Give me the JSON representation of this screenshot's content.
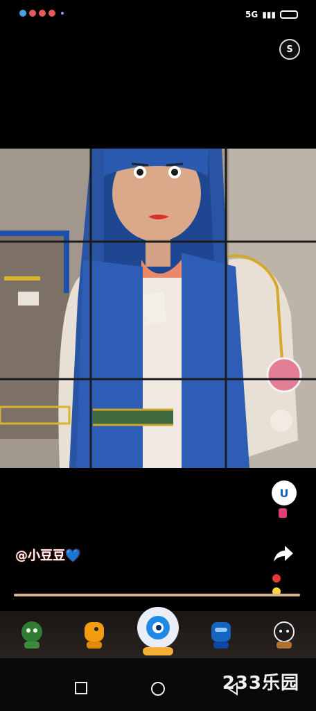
{
  "status_bar": {
    "right_text": "5G"
  },
  "top_icon": {
    "label": "S"
  },
  "photo": {
    "subject": "clay-figure-portrait",
    "grid": "3x3"
  },
  "side_actions": [
    {
      "name": "avatar-sticker",
      "icon": "avatar-icon"
    },
    {
      "name": "face-sticker",
      "icon": "face-icon"
    },
    {
      "name": "comment",
      "icon": "comment-icon",
      "label": "U"
    },
    {
      "name": "share",
      "icon": "share-icon"
    }
  ],
  "username": "@小豆豆💙",
  "dock": {
    "items": [
      {
        "name": "green-character",
        "color": "#2e7d32"
      },
      {
        "name": "orange-character",
        "color": "#f39c12"
      },
      {
        "name": "blue-eye-character",
        "color": "#1e88e5"
      },
      {
        "name": "blue-character",
        "color": "#1565c0"
      },
      {
        "name": "black-character",
        "color": "#222222"
      }
    ]
  },
  "watermark": "233乐园"
}
